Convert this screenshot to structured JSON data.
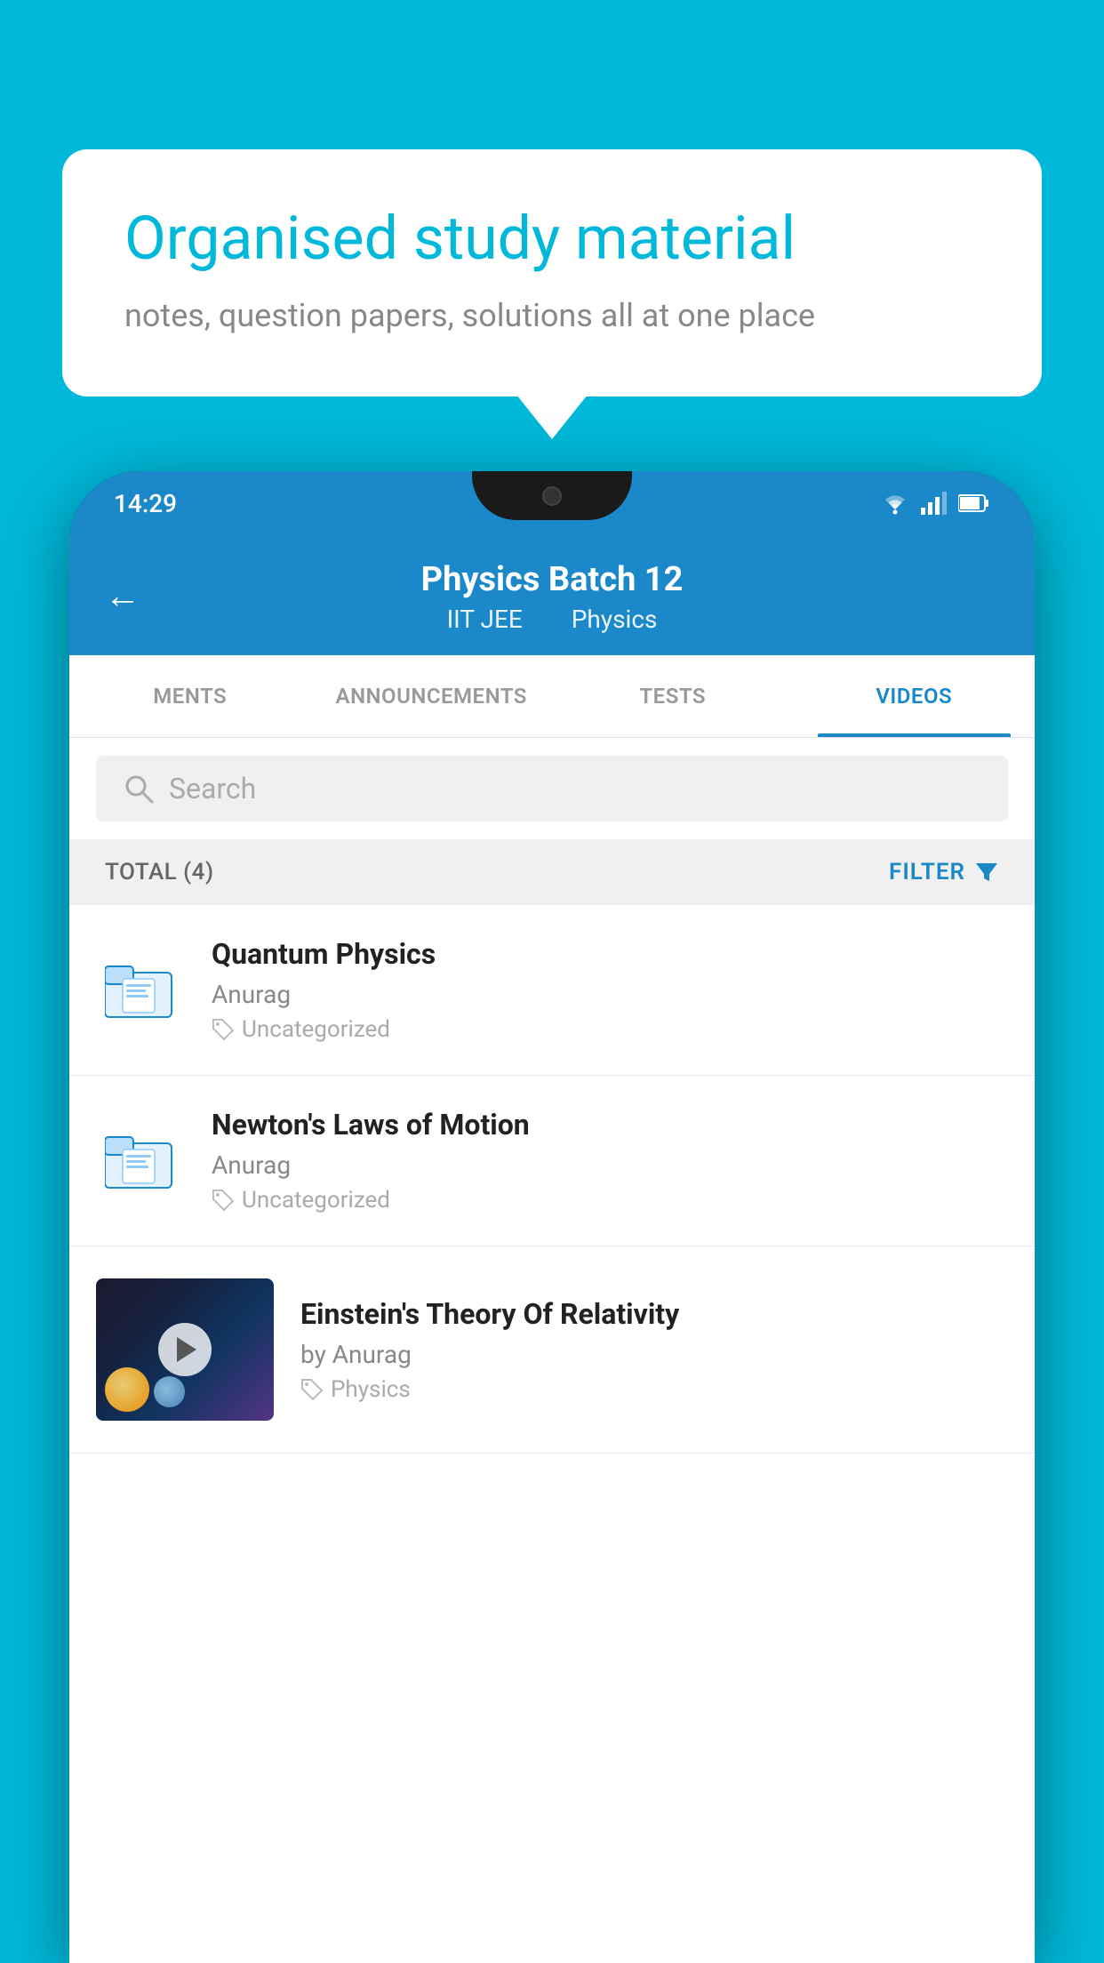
{
  "background_color": "#00B8D9",
  "speech_bubble": {
    "title": "Organised study material",
    "subtitle": "notes, question papers, solutions all at one place"
  },
  "phone": {
    "status_bar": {
      "time": "14:29"
    },
    "app_bar": {
      "title": "Physics Batch 12",
      "subtitle_part1": "IIT JEE",
      "subtitle_part2": "Physics",
      "back_label": "←"
    },
    "tabs": [
      {
        "label": "MENTS",
        "active": false
      },
      {
        "label": "ANNOUNCEMENTS",
        "active": false
      },
      {
        "label": "TESTS",
        "active": false
      },
      {
        "label": "VIDEOS",
        "active": true
      }
    ],
    "search": {
      "placeholder": "Search"
    },
    "filter_bar": {
      "total_label": "TOTAL (4)",
      "filter_label": "FILTER"
    },
    "videos": [
      {
        "id": 1,
        "title": "Quantum Physics",
        "author": "Anurag",
        "tag": "Uncategorized",
        "type": "folder"
      },
      {
        "id": 2,
        "title": "Newton's Laws of Motion",
        "author": "Anurag",
        "tag": "Uncategorized",
        "type": "folder"
      },
      {
        "id": 3,
        "title": "Einstein's Theory Of Relativity",
        "author": "by Anurag",
        "tag": "Physics",
        "type": "video"
      }
    ]
  }
}
